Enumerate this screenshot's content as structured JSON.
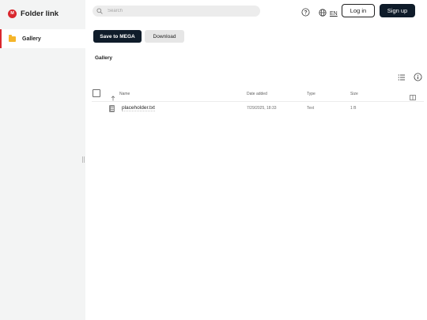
{
  "app": {
    "title": "Folder link",
    "logo_letter": "M"
  },
  "sidebar": {
    "items": [
      {
        "label": "Gallery"
      }
    ]
  },
  "search": {
    "placeholder": "Search"
  },
  "header": {
    "language": "EN",
    "login_label": "Log in",
    "signup_label": "Sign up"
  },
  "toolbar": {
    "save_label": "Save to MEGA",
    "download_label": "Download"
  },
  "breadcrumb": {
    "current": "Gallery"
  },
  "table": {
    "columns": {
      "name": "Name",
      "date": "Date added",
      "type": "Type",
      "size": "Size"
    },
    "rows": [
      {
        "name": "placeholder.txt",
        "date": "7/29/2025, 18:33",
        "type": "Text",
        "size": "1 B"
      }
    ]
  },
  "colors": {
    "brand_red": "#d9272e",
    "primary_dark": "#0f1c2a",
    "folder_yellow": "#f5b52a",
    "sidebar_bg": "#f3f4f4"
  }
}
